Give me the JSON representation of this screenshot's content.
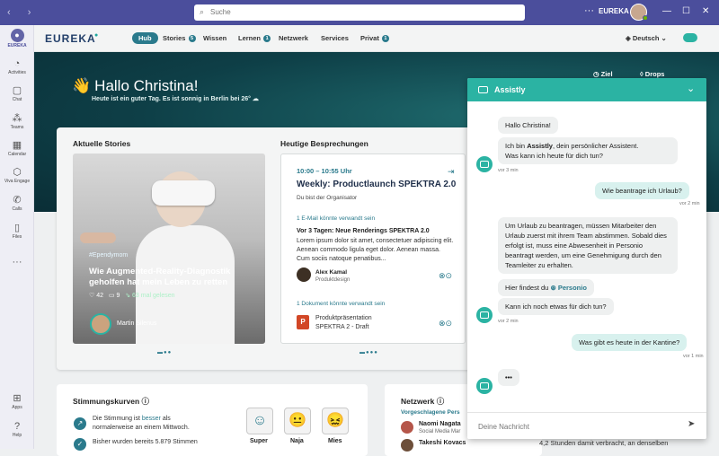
{
  "titlebar": {
    "search_placeholder": "Suche",
    "app": "EUREKA",
    "more": "···",
    "min": "—",
    "max": "☐",
    "close": "✕"
  },
  "rail": [
    {
      "label": "EUREKA",
      "icon": "eureka-icon",
      "glyph": "●"
    },
    {
      "label": "Activities",
      "icon": "bell-icon",
      "glyph": "🔔"
    },
    {
      "label": "Chat",
      "icon": "chat-icon",
      "glyph": "💬"
    },
    {
      "label": "Teams",
      "icon": "teams-icon",
      "glyph": "👥"
    },
    {
      "label": "Calendar",
      "icon": "calendar-icon",
      "glyph": "📅"
    },
    {
      "label": "Viva Engage",
      "icon": "engage-icon",
      "glyph": "⬡"
    },
    {
      "label": "Calls",
      "icon": "phone-icon",
      "glyph": "✆"
    },
    {
      "label": "Files",
      "icon": "file-icon",
      "glyph": "🗋"
    },
    {
      "label": "",
      "icon": "more-icon",
      "glyph": "···"
    },
    {
      "label": "Apps",
      "icon": "apps-icon",
      "glyph": "⊞"
    },
    {
      "label": "Help",
      "icon": "help-icon",
      "glyph": "?"
    }
  ],
  "nav": {
    "logo": "EUREKA",
    "items": [
      {
        "label": "Hub"
      },
      {
        "label": "Stories",
        "badge": "5"
      },
      {
        "label": "Wissen"
      },
      {
        "label": "Lernen",
        "badge": "1"
      },
      {
        "label": "Netzwerk"
      },
      {
        "label": "Services"
      },
      {
        "label": "Privat",
        "badge": "1"
      }
    ],
    "language": "Deutsch ⌄"
  },
  "hero": {
    "greeting": "Hallo Christina!",
    "subtitle": "Heute ist ein guter Tag. Es ist sonnig in Berlin bei 26°",
    "goal": "Ziel",
    "drops": "Drops"
  },
  "stories": {
    "section_title": "Aktuelle Stories",
    "tag": "#Ependymom",
    "title": "Wie Augmented-Reality-Diagnostik geholfen hat mein Leben zu retten",
    "likes": "42",
    "comments": "9",
    "reads": "63 mal gelesen",
    "author": "Martin Silenus"
  },
  "meetings": {
    "section_title": "Heutige Besprechungen",
    "time": "10:00 – 10:55 Uhr",
    "title": "Weekly: Productlaunch SPEKTRA 2.0",
    "organizer": "Du bist der Organisator",
    "mail_hint": "1 E-Mail könnte verwandt sein",
    "mail_title": "Vor 3 Tagen: Neue Renderings SPEKTRA 2.0",
    "mail_body": "Lorem ipsum dolor sit amet, consectetuer adipiscing elit. Aenean commodo ligula eget dolor. Aenean massa. Cum sociis natoque penatibus...",
    "sender": "Alex Kamal",
    "sender_role": "Produktdesign",
    "doc_hint": "1 Dokument könnte verwandt sein",
    "doc_name": "Produktpräsentation",
    "doc_name2": "SPEKTRA 2 - Draft",
    "doc_letter": "P"
  },
  "mood": {
    "section_title": "Stimmungskurven",
    "line1_a": "Die Stimmung ist ",
    "line1_hl": "besser",
    "line1_b": " als",
    "line2": "normalerweise an einem Mittwoch.",
    "line3": "Bisher wurden bereits 5.879 Stimmen",
    "faces": [
      {
        "label": "Super",
        "glyph": "☺"
      },
      {
        "label": "Naja",
        "glyph": "😐"
      },
      {
        "label": "Mies",
        "glyph": "😖"
      }
    ]
  },
  "network": {
    "section_title": "Netzwerk",
    "subtitle": "Vorgeschlagene Pers",
    "people": [
      {
        "name": "Naomi Nagata",
        "role": "Social Media Mar"
      },
      {
        "name": "Takeshi Kovacs",
        "role": ""
      }
    ]
  },
  "bottom_note": "4,2 Stunden damit verbracht, an denselben",
  "assistant": {
    "title": "Assistly",
    "messages": {
      "m1": "Hallo Christina!",
      "m2_a": "Ich bin ",
      "m2_b": "Assistly",
      "m2_c": ", dein persönlicher Assistent.",
      "m2_d": "Was kann ich heute für dich tun?",
      "t1": "vor 3 min",
      "u1": "Wie beantrage ich Urlaub?",
      "t2": "vor 2 min",
      "m3": "Um Urlaub zu beantragen, müssen Mitarbeiter den Urlaub zuerst mit ihrem Team abstimmen. Sobald dies erfolgt ist, muss eine Abwesenheit in Personio beantragt werden, um eine Genehmigung durch den Teamleiter zu erhalten.",
      "m4_a": "Hier findest du ",
      "m4_link": "Personio",
      "m5": "Kann ich noch etwas für dich tun?",
      "t3": "vor 2 min",
      "u2": "Was gibt es heute in der Kantine?",
      "t4": "vor 1 min",
      "typing": "•••"
    },
    "input_placeholder": "Deine Nachricht"
  }
}
